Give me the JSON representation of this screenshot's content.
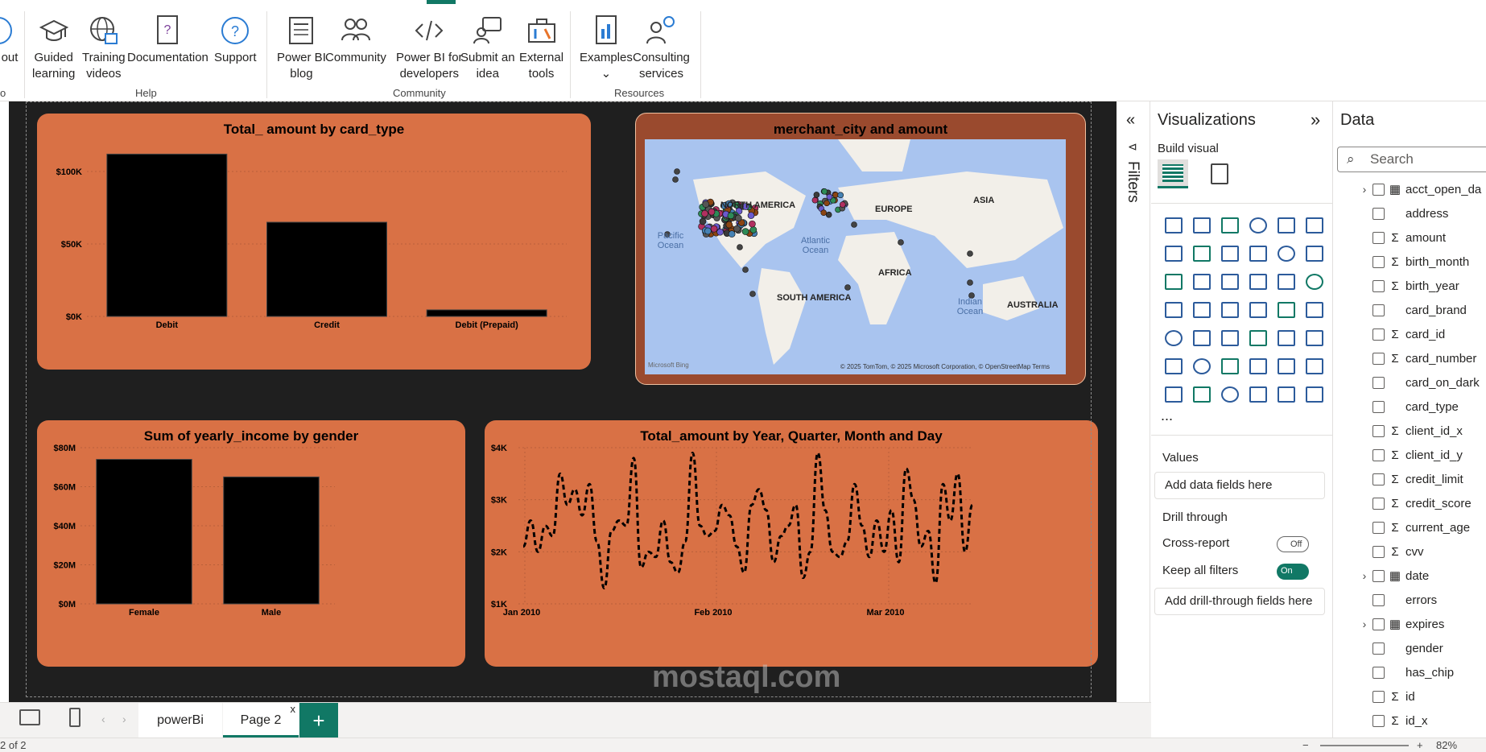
{
  "ribbon": {
    "help_group": "Help",
    "community_group": "Community",
    "resources_group": "Resources",
    "about_partial": "out",
    "guided_learning": [
      "Guided",
      "learning"
    ],
    "training_videos": [
      "Training",
      "videos"
    ],
    "documentation": "Documentation",
    "support": "Support",
    "powerbi_blog": [
      "Power BI",
      "blog"
    ],
    "community": "Community",
    "powerbi_dev": [
      "Power BI for",
      "developers"
    ],
    "submit_idea": [
      "Submit an",
      "idea"
    ],
    "external_tools": [
      "External",
      "tools"
    ],
    "examples": "Examples",
    "consulting": [
      "Consulting",
      "services"
    ],
    "left_group_partial": "o"
  },
  "visuals": {
    "card_type": {
      "title": "Total_ amount by card_type",
      "chart_data": {
        "type": "bar",
        "title": "Total_ amount by card_type",
        "categories": [
          "Debit",
          "Credit",
          "Debit (Prepaid)"
        ],
        "values": [
          112000,
          65000,
          4500
        ],
        "yticks": [
          "$0K",
          "$50K",
          "$100K"
        ],
        "ylim": [
          0,
          120000
        ]
      }
    },
    "map": {
      "title": "merchant_city and amount",
      "labels": {
        "north_america": "NORTH AMERICA",
        "europe": "EUROPE",
        "asia": "ASIA",
        "africa": "AFRICA",
        "south_america": "SOUTH AMERICA",
        "australia": "AUSTRALIA",
        "pacific": "Pacific Ocean",
        "atlantic": "Atlantic Ocean",
        "indian": "Indian Ocean"
      },
      "copyright": "© 2025 TomTom, © 2025 Microsoft Corporation, © OpenStreetMap  Terms",
      "bing": "Microsoft Bing"
    },
    "gender": {
      "title": "Sum of yearly_income by gender",
      "chart_data": {
        "type": "bar",
        "title": "Sum of yearly_income by gender",
        "categories": [
          "Female",
          "Male"
        ],
        "values": [
          74000000,
          65000000
        ],
        "yticks": [
          "$0M",
          "$20M",
          "$40M",
          "$60M",
          "$80M"
        ],
        "ylim": [
          0,
          80000000
        ]
      }
    },
    "timeline": {
      "title": "Total_amount by Year, Quarter, Month and Day",
      "chart_data": {
        "type": "line",
        "title": "Total_amount by Year, Quarter, Month and Day",
        "xticks": [
          "Jan 2010",
          "Feb 2010",
          "Mar 2010"
        ],
        "yticks": [
          "$1K",
          "$2K",
          "$3K",
          "$4K"
        ],
        "ylim": [
          1000,
          4000
        ],
        "values": [
          2100,
          2600,
          2000,
          2500,
          2300,
          3500,
          2900,
          3200,
          2700,
          3300,
          2200,
          1300,
          2400,
          2600,
          2500,
          3800,
          1700,
          2000,
          1900,
          2600,
          1800,
          1600,
          2200,
          3900,
          2500,
          2300,
          2400,
          2900,
          2700,
          2100,
          1600,
          2900,
          3200,
          2800,
          1800,
          2300,
          2500,
          2900,
          1500,
          2000,
          3900,
          2800,
          2000,
          1900,
          2200,
          3300,
          2500,
          1900,
          2600,
          2000,
          2800,
          1800,
          3600,
          3000,
          2100,
          2400,
          1400,
          3300,
          2600,
          3500,
          2000,
          2900
        ]
      }
    }
  },
  "filters_label": "Filters",
  "viz_pane": {
    "title": "Visualizations",
    "build_visual": "Build visual",
    "values_label": "Values",
    "add_data": "Add data fields here",
    "drill_through": "Drill through",
    "cross_report": "Cross-report",
    "cross_report_state": "Off",
    "keep_filters": "Keep all filters",
    "keep_filters_state": "On",
    "add_drill": "Add drill-through fields here",
    "more": "..."
  },
  "data_pane": {
    "title": "Data",
    "search_placeholder": "Search",
    "fields": [
      {
        "name": "acct_open_da",
        "sym": "cal",
        "chev": true
      },
      {
        "name": "address",
        "sym": ""
      },
      {
        "name": "amount",
        "sym": "Σ"
      },
      {
        "name": "birth_month",
        "sym": "Σ"
      },
      {
        "name": "birth_year",
        "sym": "Σ"
      },
      {
        "name": "card_brand",
        "sym": ""
      },
      {
        "name": "card_id",
        "sym": "Σ"
      },
      {
        "name": "card_number",
        "sym": "Σ"
      },
      {
        "name": "card_on_dark",
        "sym": ""
      },
      {
        "name": "card_type",
        "sym": ""
      },
      {
        "name": "client_id_x",
        "sym": "Σ"
      },
      {
        "name": "client_id_y",
        "sym": "Σ"
      },
      {
        "name": "credit_limit",
        "sym": "Σ"
      },
      {
        "name": "credit_score",
        "sym": "Σ"
      },
      {
        "name": "current_age",
        "sym": "Σ"
      },
      {
        "name": "cvv",
        "sym": "Σ"
      },
      {
        "name": "date",
        "sym": "cal",
        "chev": true
      },
      {
        "name": "errors",
        "sym": ""
      },
      {
        "name": "expires",
        "sym": "cal",
        "chev": true
      },
      {
        "name": "gender",
        "sym": ""
      },
      {
        "name": "has_chip",
        "sym": ""
      },
      {
        "name": "id",
        "sym": "Σ"
      },
      {
        "name": "id_x",
        "sym": "Σ"
      }
    ]
  },
  "tabs": {
    "powerbi": "powerBi",
    "page2": "Page 2",
    "close": "x",
    "add": "+"
  },
  "status": {
    "page": "2 of 2",
    "zoom": "82%"
  },
  "watermark": "mostaql.com"
}
